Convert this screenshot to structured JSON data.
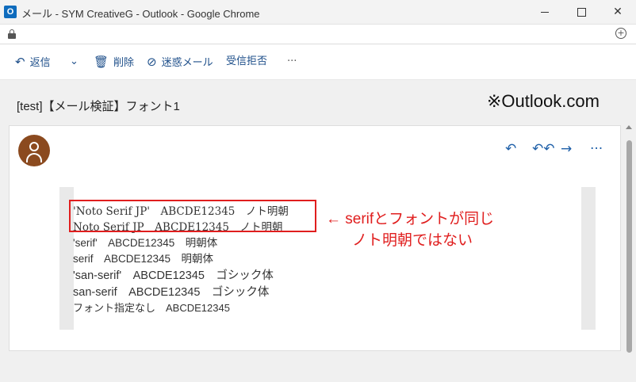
{
  "window": {
    "title": "メール - SYM CreativeG - Outlook - Google Chrome",
    "app_icon_letter": "O",
    "min_icon": "minimize-icon",
    "max_icon": "maximize-icon",
    "close_symbol": "✕"
  },
  "address_bar": {
    "lock_icon": "lock-icon",
    "zoom_symbol": "+"
  },
  "toolbar": {
    "reply_label": "返信",
    "reply_icon": "↶",
    "chevron": "⌄",
    "delete_label": "削除",
    "delete_icon": "🗑",
    "junk_label": "迷惑メール",
    "junk_icon": "⊘",
    "block_label": "受信拒否",
    "more": "···"
  },
  "message": {
    "subject": "[test]【メール検証】フォント1",
    "source_label": "※Outlook.com",
    "actions": {
      "reply": "↶",
      "reply_all": "↶↶",
      "forward": "→",
      "more": "···"
    },
    "body_lines": [
      "'Noto Serif JP'　ABCDE12345　ノト明朝",
      "Noto Serif JP　ABCDE12345　ノト明朝",
      "'serif'　ABCDE12345　明朝体",
      "serif　ABCDE12345　明朝体",
      "'san-serif'　ABCDE12345　ゴシック体",
      "san-serif　ABCDE12345　ゴシック体",
      "フォント指定なし　ABCDE12345"
    ],
    "annotation_line1": "← serifとフォントが同じ",
    "annotation_line2": "ノト明朝ではない"
  },
  "colors": {
    "accent": "#1e5fa8",
    "annotation": "#e01e1e",
    "avatar": "#8b4a1f"
  }
}
